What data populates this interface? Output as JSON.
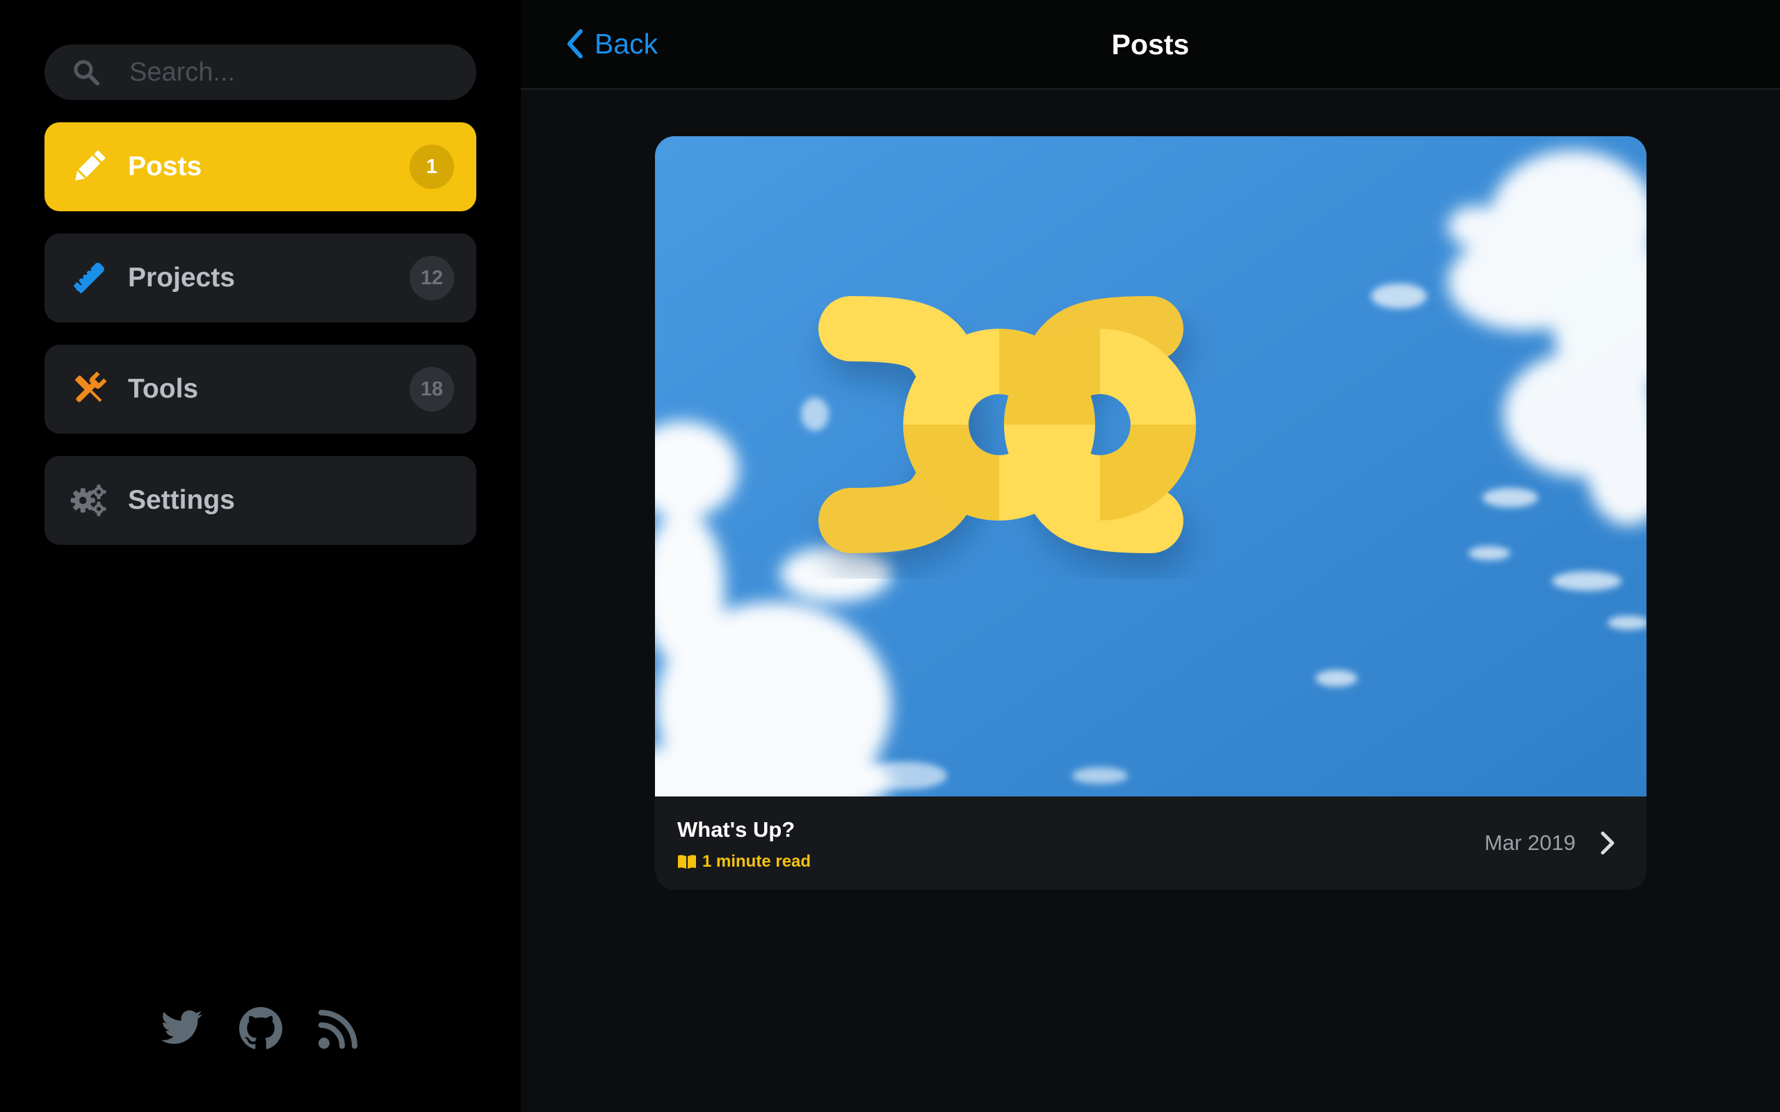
{
  "search": {
    "placeholder": "Search..."
  },
  "sidebar": {
    "items": [
      {
        "label": "Posts",
        "badge": "1",
        "icon": "pencil-icon",
        "color": "#ffffff",
        "active": true
      },
      {
        "label": "Projects",
        "badge": "12",
        "icon": "pencil-ruler-icon",
        "color": "#1a8fe8",
        "active": false
      },
      {
        "label": "Tools",
        "badge": "18",
        "icon": "wrench-screwdriver-icon",
        "color": "#f08a1c",
        "active": false
      },
      {
        "label": "Settings",
        "icon": "gears-icon",
        "color": "#6c7278",
        "active": false
      }
    ],
    "social": [
      "twitter-icon",
      "github-icon",
      "rss-icon"
    ]
  },
  "header": {
    "back_label": "Back",
    "title": "Posts"
  },
  "post": {
    "title": "What's Up?",
    "read_time": "1 minute read",
    "date": "Mar 2019"
  },
  "colors": {
    "accent": "#f5c30e",
    "link": "#1a8fe8",
    "sky": "#3c8fd8",
    "logo": "#ffd953"
  }
}
